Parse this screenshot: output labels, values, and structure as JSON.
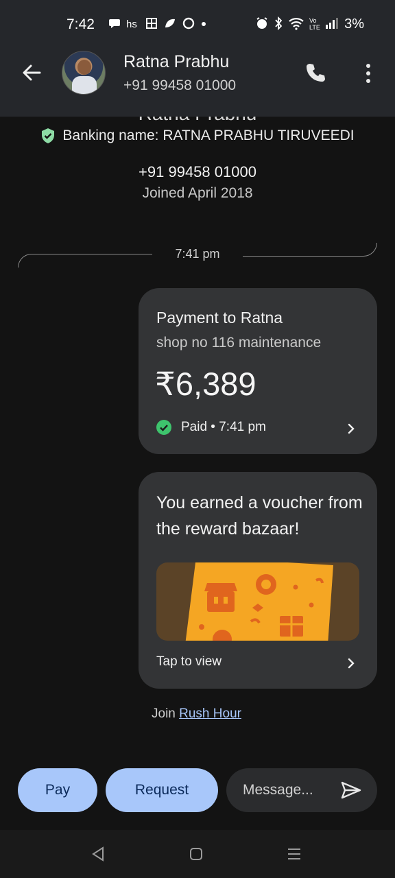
{
  "status_bar": {
    "time": "7:42",
    "battery": "3%",
    "icons": [
      "chat-icon",
      "hs-icon",
      "grid-icon",
      "leaf-icon",
      "ring-icon",
      "dot-icon",
      "alarm-icon",
      "bluetooth-icon",
      "wifi-icon",
      "volte-icon",
      "signal-icon"
    ]
  },
  "header": {
    "name": "Ratna Prabhu",
    "phone": "+91 99458 01000"
  },
  "profile": {
    "partial_name": "Ratna Prabhu",
    "banking_name": "Banking name: RATNA PRABHU TIRUVEEDI",
    "phone": "+91 99458 01000",
    "joined": "Joined April 2018"
  },
  "timeline": {
    "time": "7:41 pm"
  },
  "payment_card": {
    "title": "Payment to Ratna",
    "note": "shop no 116 maintenance",
    "amount": "₹6,389",
    "status": "Paid • 7:41 pm"
  },
  "voucher_card": {
    "title": "You earned a voucher from the reward bazaar!",
    "cta": "Tap to view"
  },
  "join": {
    "prefix": "Join ",
    "link": "Rush Hour"
  },
  "actions": {
    "pay": "Pay",
    "request": "Request",
    "message_placeholder": "Message..."
  },
  "colors": {
    "accent": "#a8c7fa",
    "success": "#3ec46d",
    "card": "#333436",
    "background": "#131313"
  }
}
